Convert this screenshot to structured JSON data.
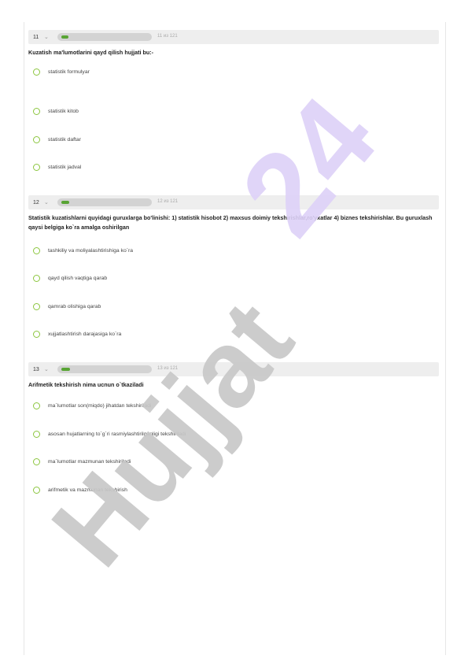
{
  "questions": [
    {
      "number": "11",
      "counter": "11 из 121",
      "progress": 0.09,
      "question": "Kuzatish ma'lumotlarini qayd qilish hujjati bu:-",
      "options": [
        "statistik formulyar",
        "statistik kitob",
        "statistik daftar",
        "statistik jadval"
      ]
    },
    {
      "number": "12",
      "counter": "12 из 121",
      "progress": 0.1,
      "question": "Statistik kuzatishlarni quyidagi guruxlarga  bo'linishi: 1) statistik hisobot 2) maxsus doimiy tekshirishlar,ro'yxatlar 4) biznes tekshirishlar. Bu guruxlash qaysi belgiga  ko`ra amalga oshirilgan",
      "options": [
        "tashkiliy va moliyalashtirishiga ko`ra",
        "qayd qilish vaqtiga qarab",
        "qamrab olishiga qarab",
        "xujjatlashtirish darajasiga ko`ra"
      ]
    },
    {
      "number": "13",
      "counter": "13 из 121",
      "progress": 0.11,
      "question": "Arifmetik tekshirish nima ucnun o`tkaziladi",
      "options": [
        "ma`lumotlar son(miqdo) jihatdan tekshiriladi",
        "asosan hujatlarning to`g`ri rasmiylashtirilganligi tekshiriladi",
        "ma`lumotlar mazmunan tekshiriladi",
        "arifmetik va mazmunan tekshirish"
      ]
    }
  ],
  "watermark": {
    "brand": "Hujjat",
    "number": "24",
    "brand_color": "#c8c8c8",
    "number_color": "#ddd0f7"
  },
  "icons": {
    "chevron": "chevron-down-icon",
    "radio": "radio-circle-icon"
  }
}
